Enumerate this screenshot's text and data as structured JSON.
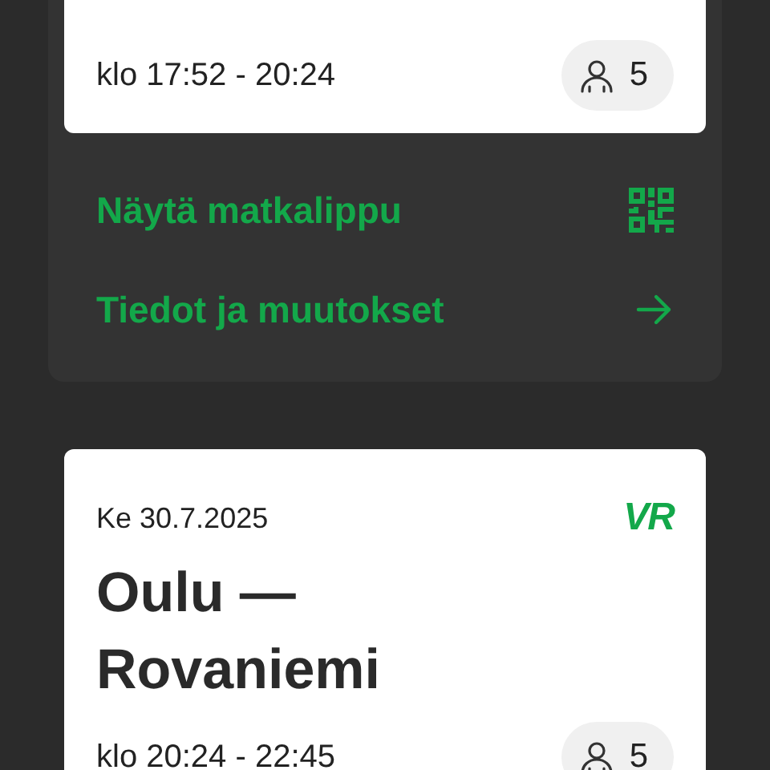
{
  "journeys": [
    {
      "time": "klo 17:52 - 20:24",
      "passengers": "5",
      "actions": [
        {
          "label": "Näytä matkalippu",
          "kind": "qr"
        },
        {
          "label": "Tiedot ja muutokset",
          "kind": "arrow"
        }
      ]
    },
    {
      "date": "Ke 30.7.2025",
      "logo": "VR",
      "title": "Oulu — Rovaniemi",
      "time": "klo 20:24 - 22:45",
      "passengers": "5"
    }
  ]
}
